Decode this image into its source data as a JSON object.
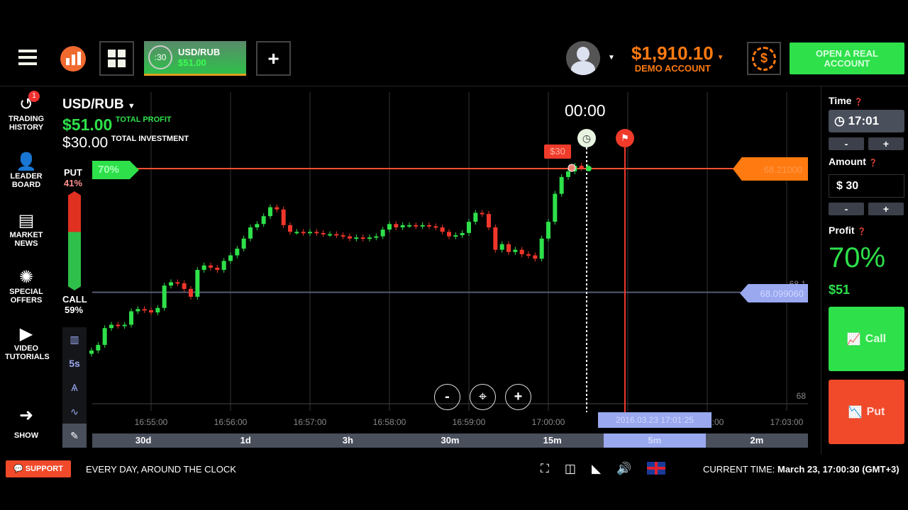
{
  "header": {
    "asset_tab": {
      "timer": ":30",
      "pair": "USD/RUB",
      "profit": "$51.00"
    },
    "balance": "$1,910.10",
    "account_type": "DEMO ACCOUNT",
    "open_real_label": "OPEN A REAL ACCOUNT"
  },
  "sidebar": {
    "items": [
      {
        "label": "TRADING HISTORY",
        "icon": "history-icon",
        "badge": "1"
      },
      {
        "label": "LEADER BOARD",
        "icon": "leaderboard-icon"
      },
      {
        "label": "MARKET NEWS",
        "icon": "news-icon"
      },
      {
        "label": "SPECIAL OFFERS",
        "icon": "offers-icon"
      },
      {
        "label": "VIDEO TUTORIALS",
        "icon": "play-icon"
      },
      {
        "label": "SHOW",
        "icon": "arrow-right-icon"
      }
    ]
  },
  "chart_header": {
    "pair": "USD/RUB",
    "total_profit_value": "$51.00",
    "total_profit_label": "TOTAL PROFIT",
    "total_investment_value": "$30.00",
    "total_investment_label": "TOTAL INVESTMENT",
    "countdown": "00:00"
  },
  "sentiment": {
    "put_label": "PUT",
    "put_pct": "41%",
    "call_label": "CALL",
    "call_pct": "59%"
  },
  "tools": [
    "5s"
  ],
  "markers": {
    "payout_pct": "70%",
    "bet_label": "$30",
    "strike_price": "68.21000",
    "current_price": "68.099060",
    "hover_date": "2016.03.23 17:01:25"
  },
  "chart_data": {
    "type": "candlestick",
    "x_ticks": [
      "16:55:00",
      "16:56:00",
      "16:57:00",
      "16:58:00",
      "16:59:00",
      "17:00:00",
      "17:01:00",
      "17:02:00",
      "17:03:00"
    ],
    "y_ticks": [
      "68",
      "68.1"
    ],
    "ylim": [
      67.99,
      68.23
    ],
    "start": "16:54:15",
    "interval_s": 5,
    "closes": [
      68.04,
      68.045,
      68.06,
      68.063,
      68.062,
      68.063,
      68.075,
      68.077,
      68.076,
      68.074,
      68.078,
      68.098,
      68.101,
      68.1,
      68.095,
      68.088,
      68.112,
      68.116,
      68.114,
      68.112,
      68.12,
      68.125,
      68.131,
      68.14,
      68.15,
      68.153,
      68.16,
      68.168,
      68.166,
      68.152,
      68.146,
      68.146,
      68.145,
      68.146,
      68.145,
      68.144,
      68.144,
      68.143,
      68.142,
      68.14,
      68.141,
      68.14,
      68.141,
      68.142,
      68.148,
      68.153,
      68.15,
      68.152,
      68.152,
      68.151,
      68.152,
      68.151,
      68.15,
      68.146,
      68.142,
      68.143,
      68.145,
      68.155,
      68.163,
      68.162,
      68.15,
      68.13,
      68.135,
      68.128,
      68.13,
      68.126,
      68.125,
      68.122,
      68.14,
      68.155,
      68.18,
      68.195,
      68.2,
      68.205,
      68.203,
      68.204
    ],
    "colors": {
      "up": "#2ee04a",
      "down": "#f0362b"
    }
  },
  "zoom_controls": {
    "minus": "-",
    "center": "⌖",
    "plus": "+"
  },
  "timeframes": [
    "30d",
    "1d",
    "3h",
    "30m",
    "15m",
    "5m",
    "2m"
  ],
  "selected_timeframe": "5m",
  "right_panel": {
    "time_label": "Time",
    "time_value": "17:01",
    "amount_label": "Amount",
    "amount_value": "$ 30",
    "profit_label": "Profit",
    "profit_pct": "70%",
    "profit_value": "$51",
    "call_label": "Call",
    "put_label": "Put",
    "minus": "-",
    "plus": "+"
  },
  "footer": {
    "support_label": "SUPPORT",
    "tagline": "EVERY DAY, AROUND THE CLOCK",
    "current_time_label": "CURRENT TIME:",
    "current_time_value": "March 23, 17:00:30 (GMT+3)"
  },
  "colors": {
    "green": "#2ee04a",
    "orange": "#ff6a00",
    "red": "#f0362b",
    "blue": "#9aa8f0"
  }
}
